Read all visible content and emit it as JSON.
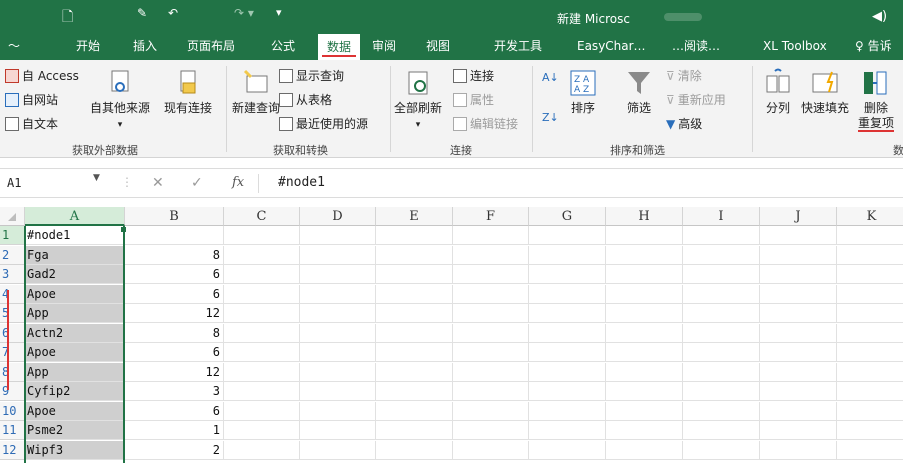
{
  "titlebar": {
    "title": "新建 Microsc",
    "right_icon": "ribbon-display-icon",
    "right_glyph": "◀)"
  },
  "tabs": [
    "开始",
    "插入",
    "页面布局",
    "公式",
    "数据",
    "审阅",
    "视图",
    "开发工具",
    "EasyChar…",
    "…阅读…",
    "XL Toolbox",
    "♀ 告诉"
  ],
  "active_tab": "数据",
  "ribbon": {
    "get_external": {
      "access": "自 Access",
      "web": "自网站",
      "text": "自文本",
      "other": "自其他来源",
      "existing": "现有连接",
      "group": "获取外部数据"
    },
    "get_transform": {
      "new_query": "新建查询",
      "show_query": "显示查询",
      "from_table": "从表格",
      "recent": "最近使用的源",
      "group": "获取和转换"
    },
    "connections": {
      "refresh_all": "全部刷新",
      "connections": "连接",
      "properties": "属性",
      "edit_links": "编辑链接",
      "group": "连接"
    },
    "sort_filter": {
      "sort": "排序",
      "filter": "筛选",
      "clear": "清除",
      "reapply": "重新应用",
      "advanced": "高级",
      "group": "排序和筛选"
    },
    "data_tools": {
      "split": "分列",
      "flash_fill": "快速填充",
      "remove_dup_line1": "删除",
      "remove_dup_line2": "重复项",
      "group": "数"
    }
  },
  "formula_bar": {
    "name_box": "A1",
    "fx_label": "fx",
    "value": "#node1"
  },
  "sheet": {
    "columns": [
      "A",
      "B",
      "C",
      "D",
      "E",
      "F",
      "G",
      "H",
      "I",
      "J",
      "K"
    ],
    "rows": [
      {
        "num": "1",
        "a": "#node1",
        "b": ""
      },
      {
        "num": "2",
        "a": "Fga",
        "b": "8"
      },
      {
        "num": "3",
        "a": "Gad2",
        "b": "6"
      },
      {
        "num": "4",
        "a": "Apoe",
        "b": "6"
      },
      {
        "num": "5",
        "a": "App",
        "b": "12"
      },
      {
        "num": "6",
        "a": "Actn2",
        "b": "8"
      },
      {
        "num": "7",
        "a": "Apoe",
        "b": "6"
      },
      {
        "num": "8",
        "a": "App",
        "b": "12"
      },
      {
        "num": "9",
        "a": "Cyfip2",
        "b": "3"
      },
      {
        "num": "10",
        "a": "Apoe",
        "b": "6"
      },
      {
        "num": "11",
        "a": "Psme2",
        "b": "1"
      },
      {
        "num": "12",
        "a": "Wipf3",
        "b": "2"
      }
    ]
  },
  "colors": {
    "accent": "#217346",
    "highlight": "#d33"
  }
}
